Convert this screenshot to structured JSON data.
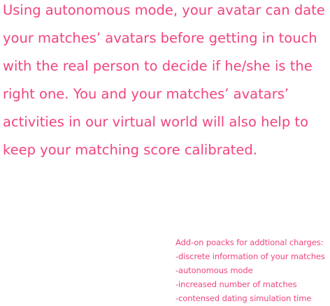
{
  "main": {
    "lines": [
      "Using autonomous mode, your avatar can date",
      "your matches’ avatars before getting in touch",
      "with the real person to decide if he/she is the",
      "right one. You and your matches’ avatars’",
      "activities in our virtual world will also help to",
      "keep your matching score calibrated."
    ]
  },
  "addons": {
    "heading": "Add-on poacks for addtional charges:",
    "items": [
      "-discrete information of your matches",
      "-autonomous mode",
      "-increased number of matches",
      "-contensed dating simulation time"
    ]
  },
  "colors": {
    "text": "#f0457e",
    "background": "#ffffff"
  }
}
